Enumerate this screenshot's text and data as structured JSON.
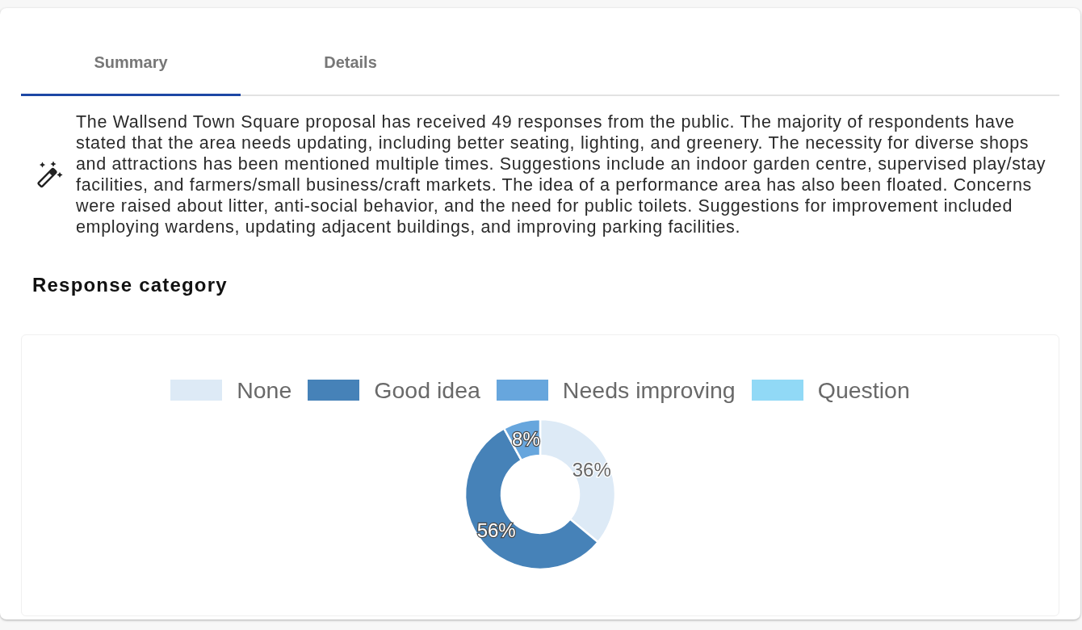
{
  "tabs": [
    {
      "label": "Summary",
      "selected": true
    },
    {
      "label": "Details",
      "selected": false
    }
  ],
  "summary": {
    "text": "The Wallsend Town Square proposal has received 49 responses from the public. The majority of respondents have stated that the area needs updating, including better seating, lighting, and greenery. The necessity for diverse shops and attractions has been mentioned multiple times. Suggestions include an indoor garden centre, supervised play/stay facilities, and farmers/small business/craft markets. The idea of a performance area has also been floated. Concerns were raised about litter, anti-social behavior, and the need for public toilets. Suggestions for improvement included employing wardens, updating adjacent buildings, and improving parking facilities."
  },
  "response_category": {
    "title": "Response category",
    "chart_data": {
      "type": "donut",
      "categories": [
        "None",
        "Good idea",
        "Needs improving",
        "Question"
      ],
      "values": [
        36,
        56,
        8,
        0
      ],
      "colors": [
        "#ddeaf6",
        "#4682b8",
        "#67a6dd",
        "#91d9f6"
      ],
      "value_labels": [
        "36%",
        "56%",
        "8%",
        null
      ],
      "legend": "top"
    }
  }
}
